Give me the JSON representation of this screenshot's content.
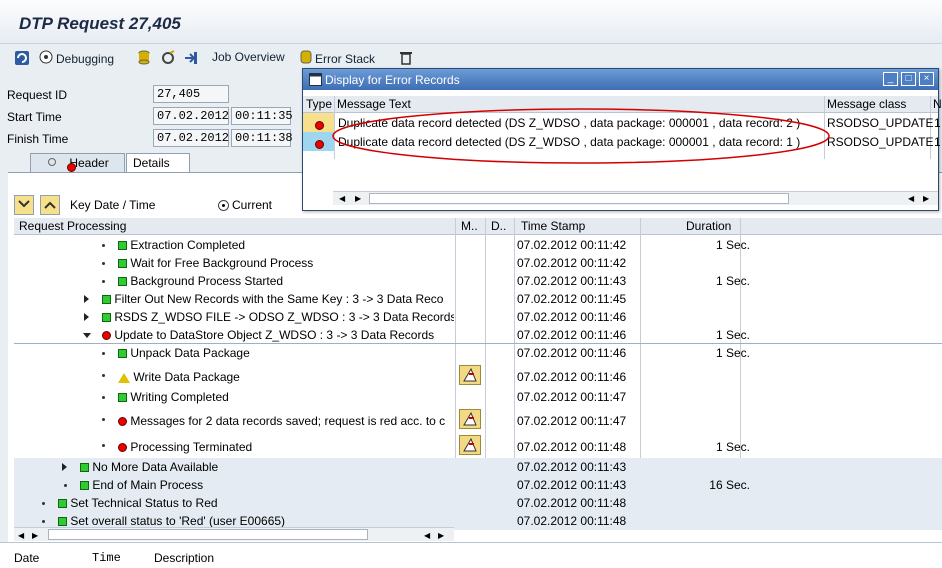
{
  "title": "DTP Request 27,405",
  "toolbar": {
    "debugging": "Debugging",
    "job_overview": "Job Overview",
    "error_stack": "Error Stack"
  },
  "fields": {
    "request_id_label": "Request ID",
    "request_id_value": "27,405",
    "start_label": "Start Time",
    "start_date": "07.02.2012",
    "start_time": "00:11:35",
    "finish_label": "Finish Time",
    "finish_date": "07.02.2012",
    "finish_time": "00:11:38"
  },
  "tabs": [
    {
      "label": "Header",
      "active": false
    },
    {
      "label": "Details",
      "active": true
    }
  ],
  "keybar": {
    "key_label": "Key Date / Time",
    "radio_label": "Current"
  },
  "tree": {
    "headers": {
      "processing": "Request Processing",
      "m": "M..",
      "d": "D..",
      "timestamp": "Time Stamp",
      "duration": "Duration"
    },
    "rows": [
      {
        "label": "Extraction Completed",
        "status": "green",
        "timestamp": "07.02.2012 00:11:42",
        "duration": "1 Sec."
      },
      {
        "label": "Wait for Free Background Process",
        "status": "green",
        "timestamp": "07.02.2012 00:11:42",
        "duration": ""
      },
      {
        "label": "Background Process Started",
        "status": "green",
        "timestamp": "07.02.2012 00:11:43",
        "duration": "1 Sec."
      },
      {
        "label": "Filter Out New Records with the Same Key : 3 -> 3 Data Reco",
        "status": "green",
        "timestamp": "07.02.2012 00:11:45",
        "duration": ""
      },
      {
        "label": "RSDS Z_WDSO FILE -> ODSO Z_WDSO : 3 -> 3 Data Records",
        "status": "green",
        "timestamp": "07.02.2012 00:11:46",
        "duration": ""
      },
      {
        "label": "Update to DataStore Object Z_WDSO : 3 -> 3 Data Records",
        "status": "red",
        "timestamp": "07.02.2012 00:11:46",
        "duration": "1 Sec."
      },
      {
        "label": "Unpack Data Package",
        "status": "green",
        "timestamp": "07.02.2012 00:11:46",
        "duration": "1 Sec."
      },
      {
        "label": "Write Data Package",
        "status": "yellow",
        "timestamp": "07.02.2012 00:11:46",
        "duration": ""
      },
      {
        "label": "Writing Completed",
        "status": "green",
        "timestamp": "07.02.2012 00:11:47",
        "duration": ""
      },
      {
        "label": "Messages for 2 data records saved; request is red acc. to c",
        "status": "red",
        "timestamp": "07.02.2012 00:11:47",
        "duration": ""
      },
      {
        "label": "Processing Terminated",
        "status": "red",
        "timestamp": "07.02.2012 00:11:48",
        "duration": "1 Sec."
      },
      {
        "label": "No More Data Available",
        "status": "green",
        "timestamp": "07.02.2012 00:11:43",
        "duration": ""
      },
      {
        "label": "End of Main Process",
        "status": "green",
        "timestamp": "07.02.2012 00:11:43",
        "duration": "16 Sec."
      },
      {
        "label": "Set Technical Status to Red",
        "status": "green",
        "timestamp": "07.02.2012 00:11:48",
        "duration": ""
      },
      {
        "label": "Set overall status to 'Red' (user E00665)",
        "status": "green",
        "timestamp": "07.02.2012 00:11:48",
        "duration": ""
      }
    ]
  },
  "bottom": {
    "date": "Date",
    "time": "Time",
    "description": "Description"
  },
  "popup": {
    "title": "Display for Error Records",
    "headers": {
      "type": "Type",
      "message": "Message Text",
      "class": "Message class",
      "no": "N"
    },
    "rows": [
      {
        "message": "Duplicate data record detected (DS Z_WDSO , data package: 000001 , data record: 2 )",
        "class": "RSODSO_UPDATE",
        "no": "1"
      },
      {
        "message": "Duplicate data record detected (DS Z_WDSO , data package: 000001 , data record: 1 )",
        "class": "RSODSO_UPDATE",
        "no": "1"
      }
    ]
  },
  "colors": {
    "accent": "#3d6eb4",
    "ok": "#2ecc2e",
    "error": "#e00000",
    "warning": "#e0c000",
    "annotation": "#d40000"
  }
}
